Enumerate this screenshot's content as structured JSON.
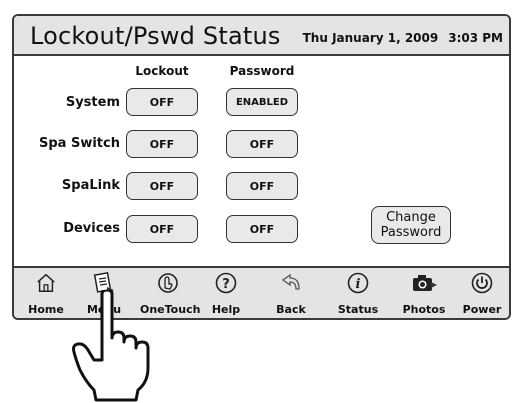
{
  "header": {
    "title": "Lockout/Pswd Status",
    "date": "Thu January 1, 2009",
    "time": "3:03 PM"
  },
  "columns": {
    "lockout": "Lockout",
    "password": "Password"
  },
  "rows": [
    {
      "label": "System",
      "lockout": "OFF",
      "password": "ENABLED"
    },
    {
      "label": "Spa Switch",
      "lockout": "OFF",
      "password": "OFF"
    },
    {
      "label": "SpaLink",
      "lockout": "OFF",
      "password": "OFF"
    },
    {
      "label": "Devices",
      "lockout": "OFF",
      "password": "OFF"
    }
  ],
  "change_password": {
    "line1": "Change",
    "line2": "Password"
  },
  "nav": [
    {
      "label": "Home",
      "icon": "home-icon"
    },
    {
      "label": "Menu",
      "icon": "menu-icon"
    },
    {
      "label": "OneTouch",
      "icon": "onetouch-icon"
    },
    {
      "label": "Help",
      "icon": "help-icon"
    },
    {
      "label": "Back",
      "icon": "back-icon"
    },
    {
      "label": "Status",
      "icon": "info-icon"
    },
    {
      "label": "Photos",
      "icon": "camera-icon"
    },
    {
      "label": "Power",
      "icon": "power-icon"
    }
  ],
  "overlay": {
    "icon": "pointing-hand-icon"
  }
}
